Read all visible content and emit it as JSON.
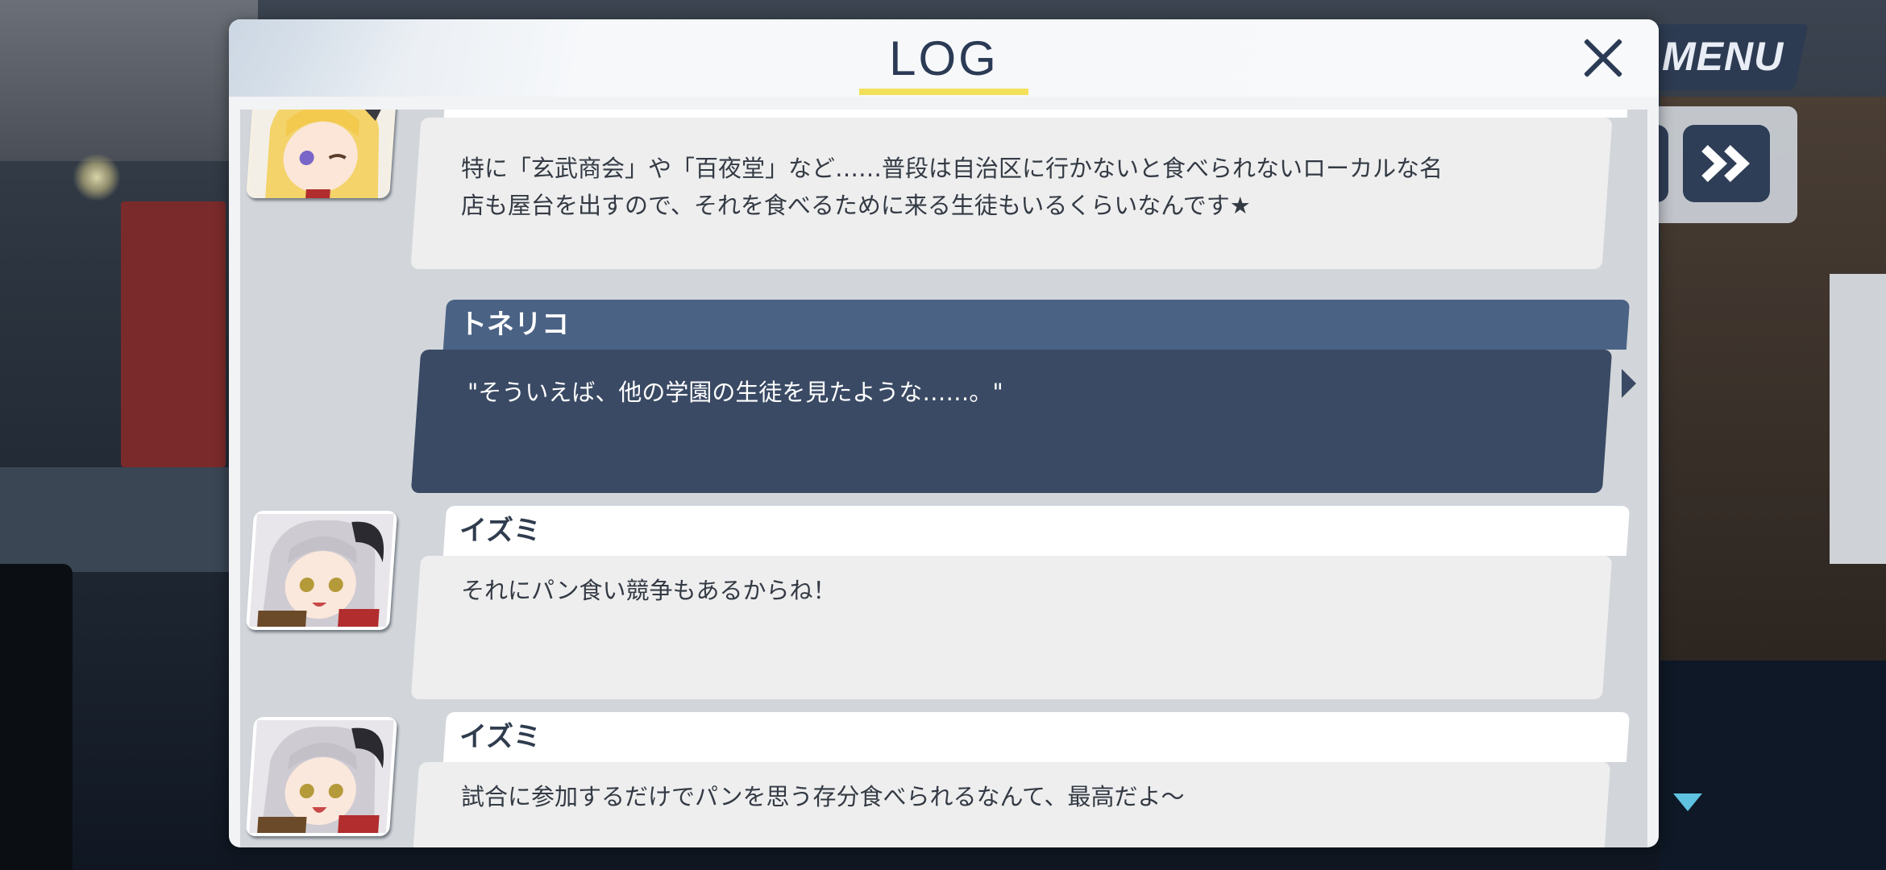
{
  "hud": {
    "menu_label": "MENU",
    "fast_forward_icon": "fast-forward-icon",
    "scroll_indicator_icon": "triangle-down-icon"
  },
  "log": {
    "title": "LOG",
    "close_icon": "close-icon",
    "entries": [
      {
        "speaker": "",
        "avatar": "blonde-horned-girl-avatar",
        "text": "特に「玄武商会」や「百夜堂」など……普段は自治区に行かないと食べられないローカルな名\n店も屋台を出すので、それを食べるために来る生徒もいるくらいなんです★"
      },
      {
        "speaker": "トネリコ",
        "avatar": "",
        "text": "\"そういえば、他の学園の生徒を見たような……。\""
      },
      {
        "speaker": "イズミ",
        "avatar": "silver-haired-horned-girl-avatar",
        "text": "それにパン食い競争もあるからね！"
      },
      {
        "speaker": "イズミ",
        "avatar": "silver-haired-horned-girl-avatar",
        "text": "試合に参加するだけでパンを思う存分食べられるなんて、最高だよ～"
      }
    ]
  },
  "colors": {
    "dialog_bg": "#f2f3f5",
    "title_text": "#2b3b55",
    "title_underline": "#f3e05a",
    "self_name_bar": "#4a6284",
    "self_bubble": "#3a4a64",
    "other_bubble": "#eeeeee"
  }
}
